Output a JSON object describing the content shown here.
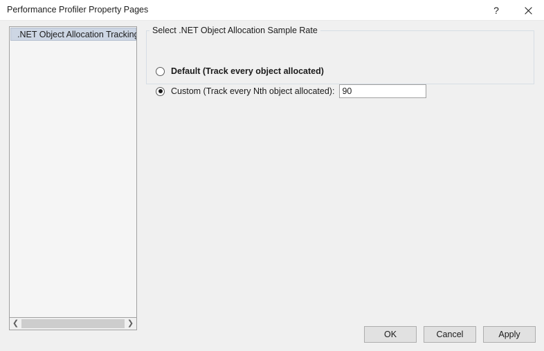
{
  "window": {
    "title": "Performance Profiler Property Pages",
    "help_glyph": "?",
    "close_glyph": "close-icon"
  },
  "tree": {
    "items": [
      {
        "label": ".NET Object Allocation Tracking",
        "selected": true
      }
    ],
    "scrollbar": {
      "left_arrow": "❮",
      "right_arrow": "❯"
    }
  },
  "groupbox": {
    "title": "Select .NET Object Allocation Sample Rate",
    "options": [
      {
        "label": "Default (Track every object allocated)",
        "selected": false,
        "bold": true
      },
      {
        "label": "Custom (Track every Nth object allocated):",
        "selected": true,
        "bold": false
      }
    ],
    "sample_rate": {
      "value": "90",
      "placeholder": ""
    }
  },
  "footer": {
    "ok_label": "OK",
    "cancel_label": "Cancel",
    "apply_label": "Apply"
  },
  "colors": {
    "dialog_background": "#f0f0f0",
    "titlebar_background": "#ffffff",
    "tree_background": "#f5f5f5",
    "selection": "#cdd6e4",
    "button_face": "#e1e1e1",
    "border": "#a0a0a0",
    "groupbox_border": "#d6dde5",
    "text": "#1a1a1a"
  }
}
